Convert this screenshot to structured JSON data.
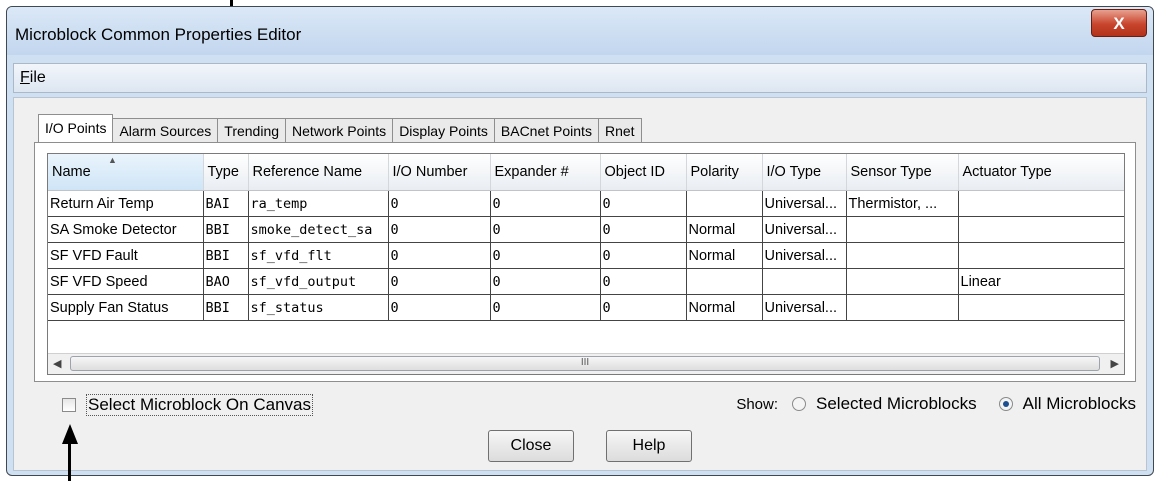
{
  "window": {
    "title": "Microblock Common Properties Editor",
    "close_glyph": "X"
  },
  "menu": {
    "file_label_rest": "ile",
    "file_mnemonic": "F"
  },
  "tabs": [
    {
      "label": "I/O Points",
      "active": true
    },
    {
      "label": "Alarm Sources"
    },
    {
      "label": "Trending"
    },
    {
      "label": "Network Points"
    },
    {
      "label": "Display Points"
    },
    {
      "label": "BACnet Points"
    },
    {
      "label": "Rnet"
    }
  ],
  "table": {
    "columns": [
      "Name",
      "Type",
      "Reference Name",
      "I/O Number",
      "Expander #",
      "Object ID",
      "Polarity",
      "I/O Type",
      "Sensor Type",
      "Actuator Type"
    ],
    "rows": [
      [
        "Return Air Temp",
        "BAI",
        "ra_temp",
        "0",
        "0",
        "0",
        "",
        "Universal...",
        "Thermistor, ...",
        ""
      ],
      [
        "SA Smoke Detector",
        "BBI",
        "smoke_detect_sa",
        "0",
        "0",
        "0",
        "Normal",
        "Universal...",
        "",
        ""
      ],
      [
        "SF VFD Fault",
        "BBI",
        "sf_vfd_flt",
        "0",
        "0",
        "0",
        "Normal",
        "Universal...",
        "",
        ""
      ],
      [
        "SF VFD Speed",
        "BAO",
        "sf_vfd_output",
        "0",
        "0",
        "0",
        "",
        "",
        "",
        "Linear"
      ],
      [
        "Supply Fan Status",
        "BBI",
        "sf_status",
        "0",
        "0",
        "0",
        "Normal",
        "Universal...",
        "",
        ""
      ]
    ],
    "scroll_grip": "III"
  },
  "options": {
    "select_on_canvas_label": "Select Microblock On Canvas",
    "select_on_canvas_checked": false,
    "show_label": "Show:",
    "radio_selected_label": "Selected Microblocks",
    "radio_all_label": "All Microblocks",
    "selected_option": "All Microblocks"
  },
  "buttons": {
    "close": "Close",
    "help": "Help"
  }
}
